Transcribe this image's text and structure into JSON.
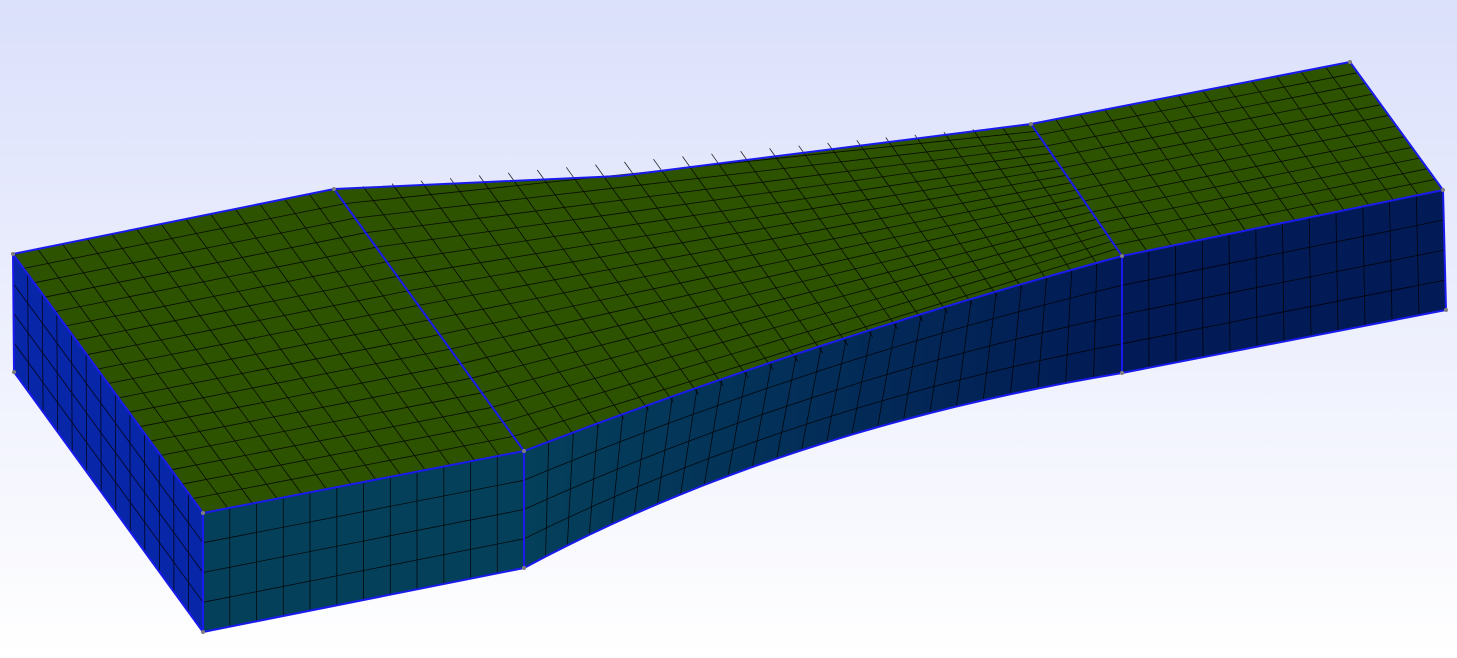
{
  "viewport": {
    "background_top": "#dbe0fb",
    "background_bottom": "#ffffff",
    "top_face_color": "#2d5200",
    "front_face_color_left": "#04405a",
    "front_face_color_right": "#021a55",
    "side_face_color": "#0826a8",
    "feature_edge_color": "#1a1aee",
    "mesh_line_color": "#000000",
    "node_color": "#7f7f7f"
  }
}
